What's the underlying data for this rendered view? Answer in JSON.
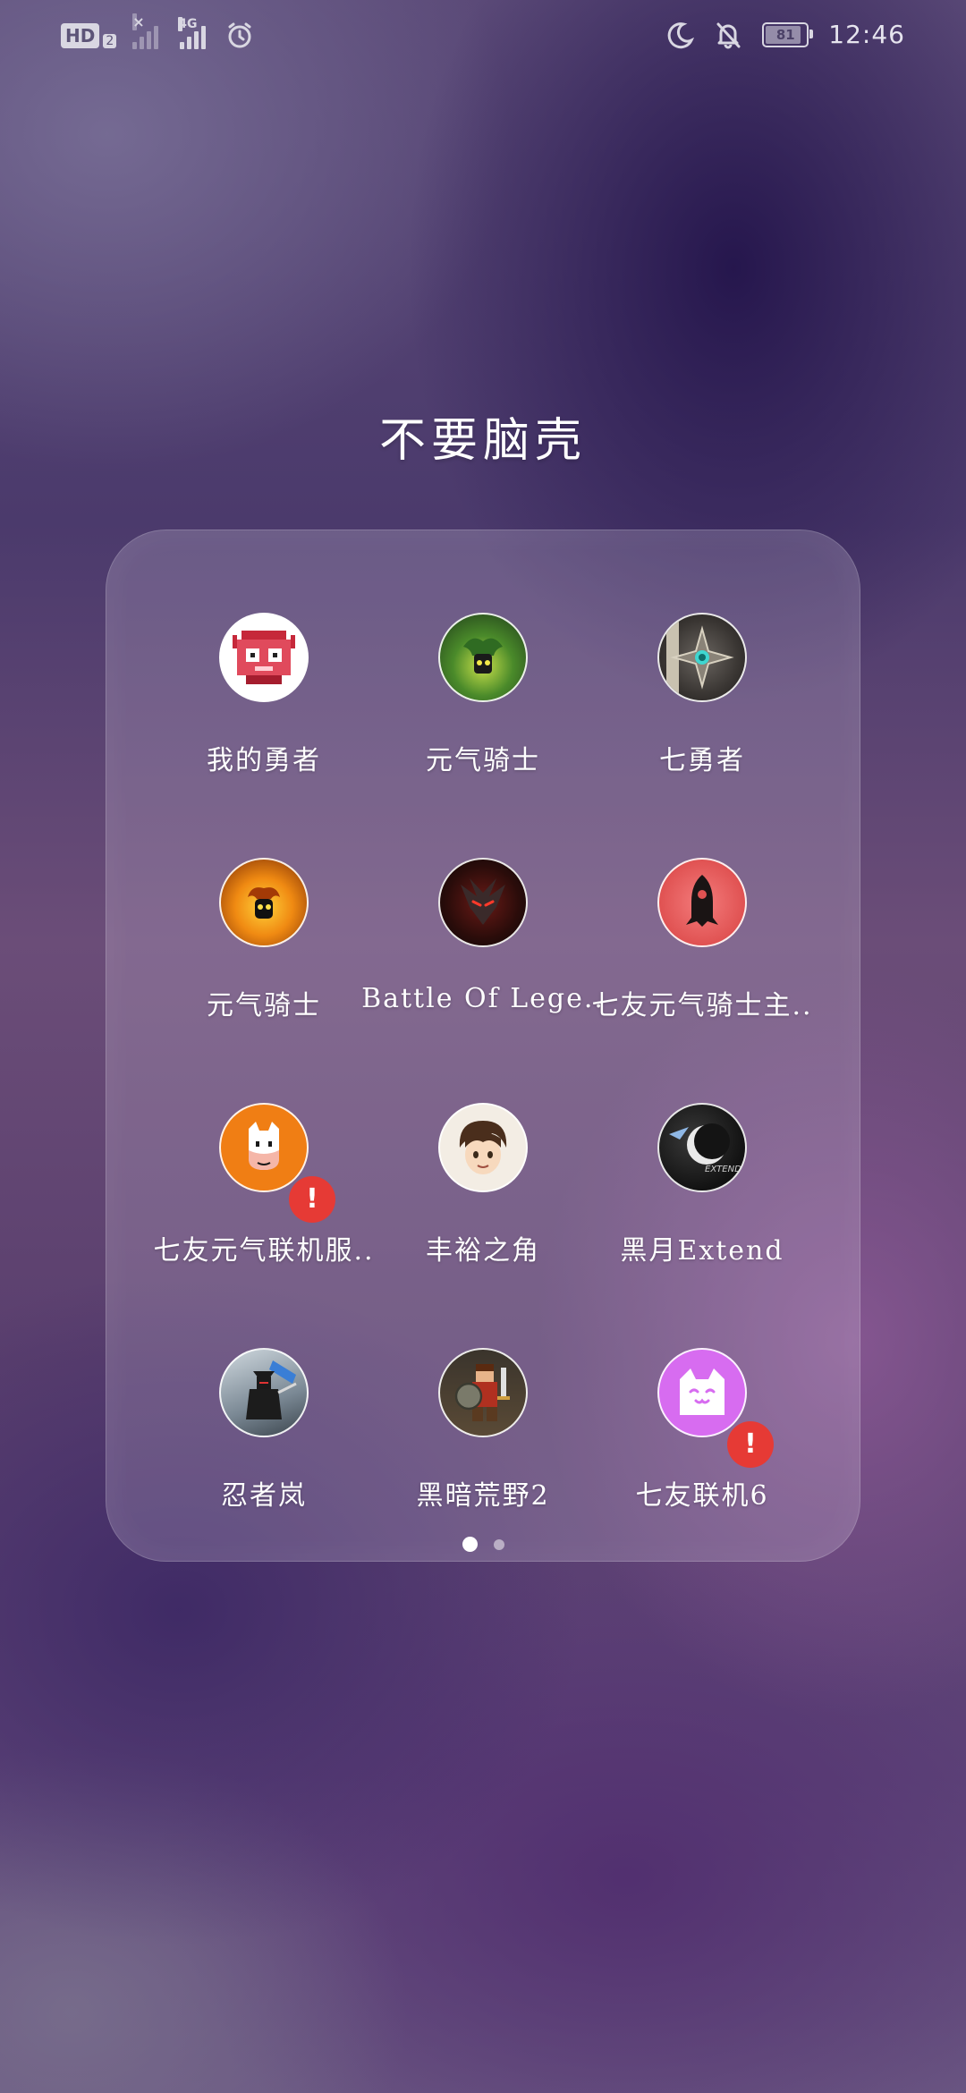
{
  "status_bar": {
    "hd_label": "HD",
    "hd_sub": "2",
    "network_label": "4G",
    "battery_level": "81",
    "time": "12:46"
  },
  "folder": {
    "title": "不要脑壳",
    "apps": [
      {
        "label": "我的勇者",
        "icon": "pixel-knight-icon",
        "badge": ""
      },
      {
        "label": "元气骑士",
        "icon": "soul-knight-green-icon",
        "badge": ""
      },
      {
        "label": "七勇者",
        "icon": "compass-star-icon",
        "badge": ""
      },
      {
        "label": "元气骑士",
        "icon": "soul-knight-fire-icon",
        "badge": ""
      },
      {
        "label": "Battle Of Lege..",
        "icon": "dark-warrior-icon",
        "badge": ""
      },
      {
        "label": "七友元气骑士主..",
        "icon": "rocket-silhouette-icon",
        "badge": ""
      },
      {
        "label": "七友元气联机服..",
        "icon": "cartoon-horse-icon",
        "badge": "!"
      },
      {
        "label": "丰裕之角",
        "icon": "anime-boy-icon",
        "badge": ""
      },
      {
        "label": "黑月Extend",
        "icon": "black-moon-icon",
        "badge": ""
      },
      {
        "label": "忍者岚",
        "icon": "ninja-icon",
        "badge": ""
      },
      {
        "label": "黑暗荒野2",
        "icon": "pixel-warrior-icon",
        "badge": ""
      },
      {
        "label": "七友联机6",
        "icon": "white-cat-icon",
        "badge": "!"
      }
    ]
  },
  "page_indicator": {
    "pages": 2,
    "current": 1
  }
}
